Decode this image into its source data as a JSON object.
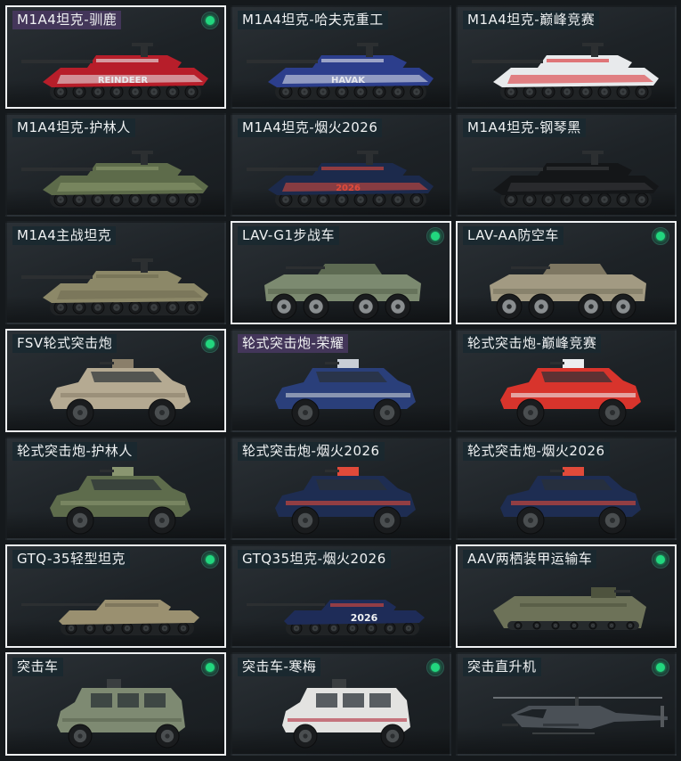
{
  "items": [
    {
      "label": "M1A4坦克-驯鹿",
      "icon": "tank-icon",
      "selected": true,
      "label_highlight": true,
      "badge": true,
      "kind": "tank",
      "body": "#b71e2a",
      "accent": "#e9ecef",
      "text": "REINDEER"
    },
    {
      "label": "M1A4坦克-哈夫克重工",
      "icon": "tank-icon",
      "selected": false,
      "label_highlight": false,
      "badge": false,
      "kind": "tank",
      "body": "#2c3e8c",
      "accent": "#e6e8ee",
      "text": "HAVAK"
    },
    {
      "label": "M1A4坦克-巅峰竞赛",
      "icon": "tank-icon",
      "selected": false,
      "label_highlight": false,
      "badge": false,
      "kind": "tank",
      "body": "#e8eaec",
      "accent": "#d8262c",
      "text": ""
    },
    {
      "label": "M1A4坦克-护林人",
      "icon": "tank-icon",
      "selected": false,
      "label_highlight": false,
      "badge": false,
      "kind": "tank",
      "body": "#5d6b4a",
      "accent": "#8c9a70",
      "text": ""
    },
    {
      "label": "M1A4坦克-烟火2026",
      "icon": "tank-icon",
      "selected": false,
      "label_highlight": false,
      "badge": false,
      "kind": "tank",
      "body": "#1c2a4c",
      "accent": "#e04a3a",
      "text": "2026"
    },
    {
      "label": "M1A4坦克-钢琴黑",
      "icon": "tank-icon",
      "selected": false,
      "label_highlight": false,
      "badge": false,
      "kind": "tank",
      "body": "#141618",
      "accent": "#3a3d40",
      "text": ""
    },
    {
      "label": "M1A4主战坦克",
      "icon": "tank-icon",
      "selected": false,
      "label_highlight": false,
      "badge": false,
      "kind": "tank",
      "body": "#8c8868",
      "accent": "#6d6a50",
      "text": ""
    },
    {
      "label": "LAV-G1步战车",
      "icon": "apc-icon",
      "selected": true,
      "label_highlight": false,
      "badge": true,
      "kind": "lav",
      "body": "#7c8a70",
      "accent": "#5d6a52",
      "text": ""
    },
    {
      "label": "LAV-AA防空车",
      "icon": "apc-icon",
      "selected": true,
      "label_highlight": false,
      "badge": true,
      "kind": "lav",
      "body": "#a29a82",
      "accent": "#7e7762",
      "text": ""
    },
    {
      "label": "FSV轮式突击炮",
      "icon": "armored-car-icon",
      "selected": true,
      "label_highlight": false,
      "badge": true,
      "kind": "car",
      "body": "#b5aa92",
      "accent": "#8a7f6a",
      "text": ""
    },
    {
      "label": "轮式突击炮-荣耀",
      "icon": "armored-car-icon",
      "selected": false,
      "label_highlight": true,
      "badge": false,
      "kind": "car",
      "body": "#2a3f7a",
      "accent": "#c9ced6",
      "text": ""
    },
    {
      "label": "轮式突击炮-巅峰竞赛",
      "icon": "armored-car-icon",
      "selected": false,
      "label_highlight": false,
      "badge": false,
      "kind": "car",
      "body": "#d8342c",
      "accent": "#eceef0",
      "text": ""
    },
    {
      "label": "轮式突击炮-护林人",
      "icon": "armored-car-icon",
      "selected": false,
      "label_highlight": false,
      "badge": false,
      "kind": "car",
      "body": "#5e6c4c",
      "accent": "#8a9670",
      "text": ""
    },
    {
      "label": "轮式突击炮-烟火2026",
      "icon": "armored-car-icon",
      "selected": false,
      "label_highlight": false,
      "badge": false,
      "kind": "car",
      "body": "#1e2d52",
      "accent": "#e04a3a",
      "text": ""
    },
    {
      "label": "轮式突击炮-烟火2026",
      "icon": "armored-car-icon",
      "selected": false,
      "label_highlight": false,
      "badge": false,
      "kind": "car",
      "body": "#1e2d52",
      "accent": "#e04a3a",
      "text": ""
    },
    {
      "label": "GTQ-35轻型坦克",
      "icon": "light-tank-icon",
      "selected": true,
      "label_highlight": false,
      "badge": true,
      "kind": "ltank",
      "body": "#9a9070",
      "accent": "#6e6850",
      "text": ""
    },
    {
      "label": "GTQ35坦克-烟火2026",
      "icon": "light-tank-icon",
      "selected": false,
      "label_highlight": false,
      "badge": false,
      "kind": "ltank",
      "body": "#1e2c58",
      "accent": "#e04a3a",
      "text": "2026"
    },
    {
      "label": "AAV两栖装甲运输车",
      "icon": "amphibious-vehicle-icon",
      "selected": true,
      "label_highlight": false,
      "badge": true,
      "kind": "aav",
      "body": "#6d7258",
      "accent": "#4e533e",
      "text": ""
    },
    {
      "label": "突击车",
      "icon": "assault-vehicle-icon",
      "selected": true,
      "label_highlight": false,
      "badge": true,
      "kind": "truck",
      "body": "#7e8a72",
      "accent": "#5c6652",
      "text": ""
    },
    {
      "label": "突击车-寒梅",
      "icon": "assault-vehicle-icon",
      "selected": false,
      "label_highlight": false,
      "badge": true,
      "kind": "truck",
      "body": "#e3e3e1",
      "accent": "#b02a3a",
      "text": ""
    },
    {
      "label": "突击直升机",
      "icon": "helicopter-icon",
      "selected": false,
      "label_highlight": false,
      "badge": true,
      "kind": "heli",
      "body": "#4a5056",
      "accent": "#33383d",
      "text": ""
    }
  ]
}
